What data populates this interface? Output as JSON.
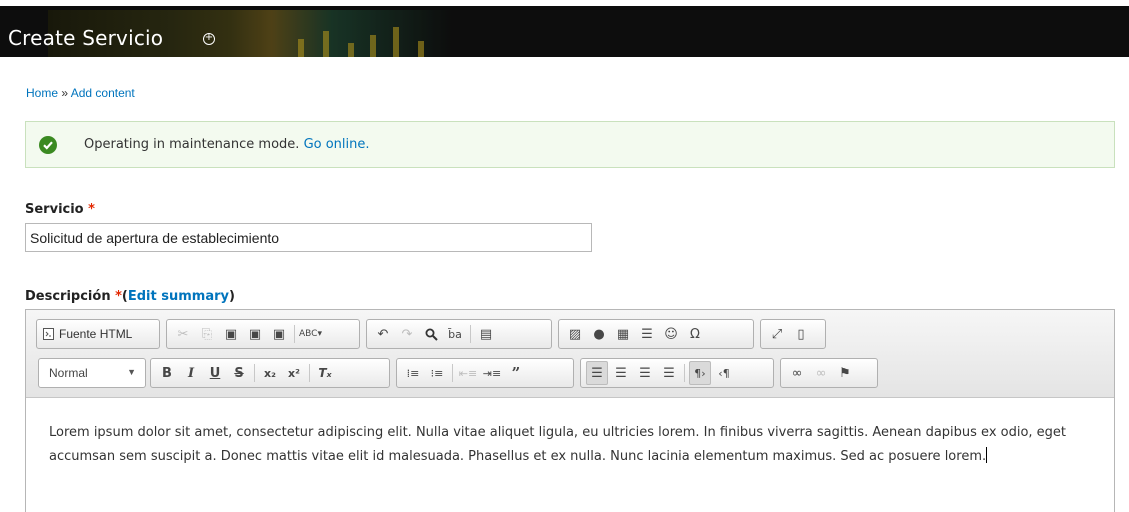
{
  "header": {
    "title": "Create Servicio",
    "shortcut_icon": "plus-circle-icon"
  },
  "breadcrumb": {
    "home": "Home",
    "separator": "»",
    "current": "Add content"
  },
  "messages": {
    "status_icon": "check-circle-icon",
    "text": "Operating in maintenance mode.",
    "link": "Go online."
  },
  "servicio": {
    "label": "Servicio",
    "required_mark": "*",
    "value": "Solicitud de apertura de establecimiento"
  },
  "descripcion": {
    "label": "Descripción",
    "required_mark": "*",
    "open_paren": "(",
    "summary_link": "Edit summary",
    "close_paren": ")"
  },
  "toolbar": {
    "source_label": "Fuente HTML",
    "format_select": "Normal",
    "icons": {
      "cut": "✂",
      "copy": "⎘",
      "paste": "📋",
      "paste_text": "📄",
      "paste_word": "🗒",
      "spellcheck": "ᴬᴮᶜ",
      "undo": "↶",
      "redo": "↷",
      "find": "🔍",
      "replace": "ᵇa",
      "select_all": "☰",
      "image": "🖼",
      "flash": "⊘",
      "table": "▦",
      "hr": "≡",
      "smiley": "☺",
      "special_char": "Ω",
      "maximize": "⛶",
      "show_blocks": "▭",
      "bold": "B",
      "italic": "I",
      "underline": "U",
      "strike": "S",
      "subscript": "x₂",
      "superscript": "x²",
      "remove_format": "Tₓ",
      "numbered_list": "⒈",
      "bulleted_list": "•≡",
      "outdent": "⇤",
      "indent": "⇥",
      "blockquote": "❞",
      "align_left": "≡",
      "align_center": "≡",
      "align_right": "≡",
      "justify": "≡",
      "ltr": "¶›",
      "rtl": "‹¶",
      "link": "⛓",
      "unlink": "⛓",
      "anchor": "⚑"
    }
  },
  "editor": {
    "content": "Lorem ipsum dolor sit amet, consectetur adipiscing elit. Nulla vitae aliquet ligula, eu ultricies lorem. In finibus viverra sagittis. Aenean dapibus ex odio, eget accumsan sem suscipit a. Donec mattis vitae elit id malesuada. Phasellus et ex nulla. Nunc lacinia elementum maximus. Sed ac posuere lorem."
  }
}
